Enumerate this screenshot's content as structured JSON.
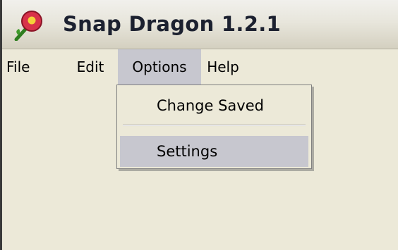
{
  "window": {
    "title": "Snap Dragon 1.2.1",
    "icon": "snapdragon-flower-icon"
  },
  "menubar": {
    "items": [
      {
        "label": "File"
      },
      {
        "label": "Edit"
      },
      {
        "label": "Options"
      },
      {
        "label": "Help"
      }
    ],
    "open_menu": "Options"
  },
  "dropdown": {
    "items": [
      {
        "label": "Change Saved"
      },
      {
        "label": "Settings",
        "highlighted": true
      }
    ]
  },
  "colors": {
    "highlight": "#c7c7cf",
    "menu_background": "#ece9d8",
    "title_text": "#1c2130"
  }
}
